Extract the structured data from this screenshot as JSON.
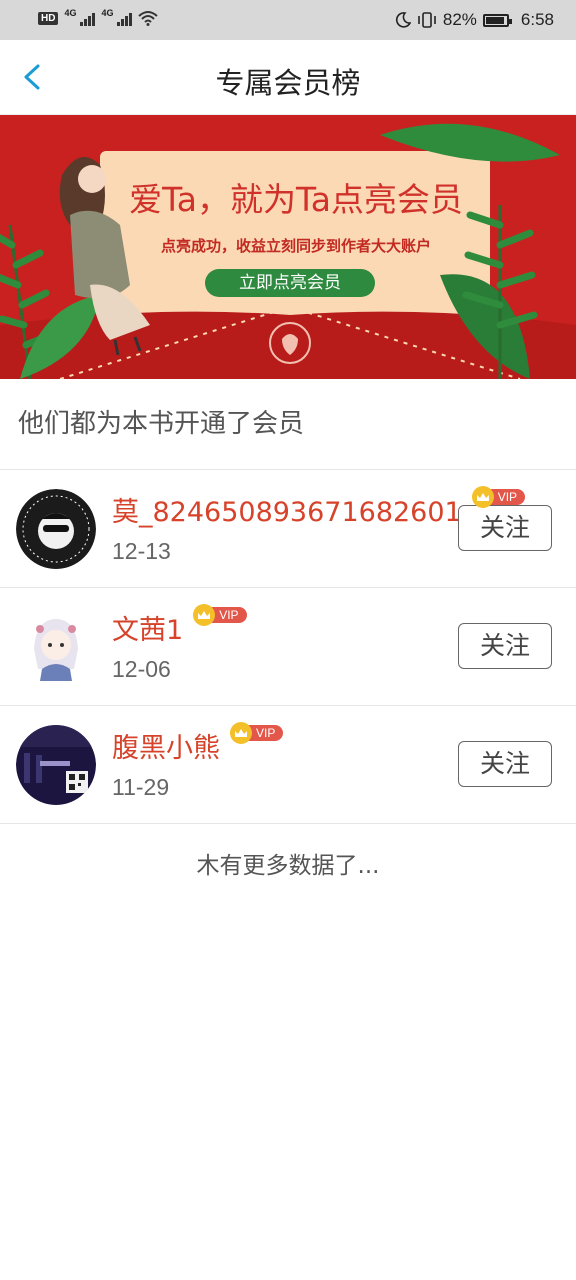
{
  "status_bar": {
    "left_label": "HD",
    "network_1": "4G",
    "network_2": "4G",
    "battery_percent": "82%",
    "battery_level": 0.82,
    "time": "6:58",
    "icons": [
      "hd-icon",
      "signal-icon",
      "signal-icon",
      "wifi-icon",
      "moon-icon",
      "vibrate-icon",
      "battery-icon"
    ]
  },
  "nav": {
    "title": "专属会员榜",
    "back_icon": "chevron-left-icon"
  },
  "banner": {
    "headline": "爱Ta，就为Ta点亮会员",
    "subline": "点亮成功，收益立刻同步到作者大大账户",
    "cta": "立即点亮会员",
    "colors": {
      "background": "#c9211f",
      "card": "#fbd9b5",
      "cta": "#2e8a3e",
      "headline": "#d0312a"
    }
  },
  "section_title": "他们都为本书开通了会员",
  "members": [
    {
      "name": "莫_824650893671682601",
      "date": "12-13",
      "vip_label": "VIP",
      "follow_label": "关注"
    },
    {
      "name": "文茜1",
      "date": "12-06",
      "vip_label": "VIP",
      "follow_label": "关注"
    },
    {
      "name": "腹黑小熊",
      "date": "11-29",
      "vip_label": "VIP",
      "follow_label": "关注"
    }
  ],
  "footer_text": "木有更多数据了...",
  "colors": {
    "accent": "#1a9bd6",
    "name": "#d6432a",
    "vip": "#e3574a"
  }
}
